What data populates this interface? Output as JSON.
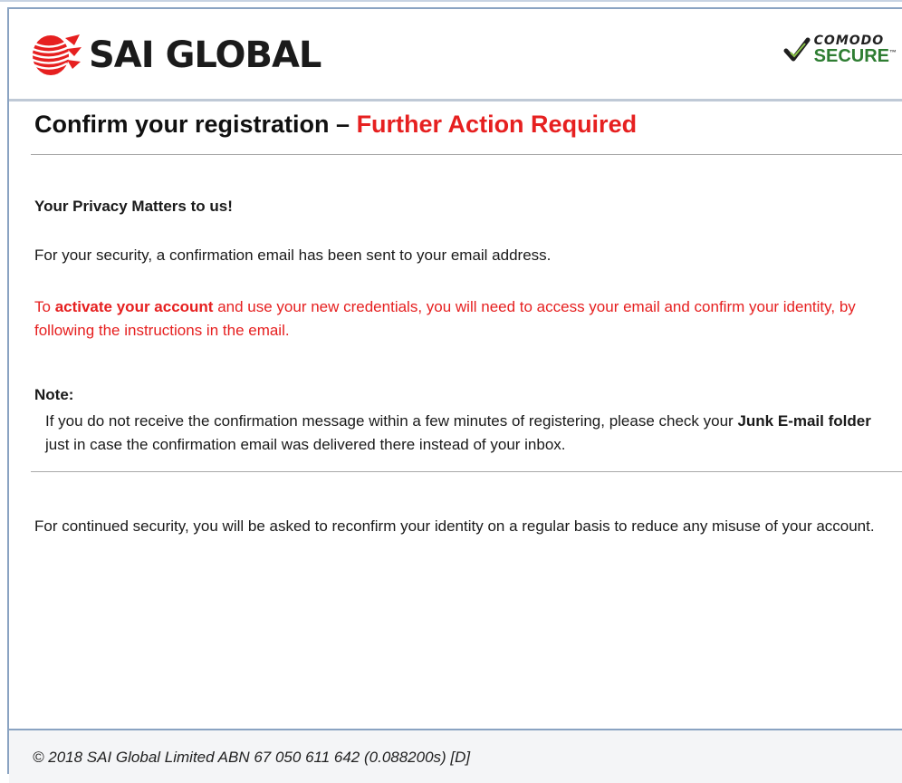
{
  "header": {
    "logo_text": "SAI GLOBAL",
    "badge_top": "COMODO",
    "badge_bottom": "SECURE",
    "badge_tm": "™"
  },
  "title": {
    "main": "Confirm your registration – ",
    "highlight": "Further Action Required"
  },
  "content": {
    "privacy_heading": "Your Privacy Matters to us!",
    "security_text": "For your security, a confirmation email has been sent to your email address.",
    "activate_pre": "To ",
    "activate_bold": "activate your account",
    "activate_post": " and use your new credentials, you will need to access your email and confirm your identity, by following the instructions in the email.",
    "note_heading": "Note:",
    "note_pre": "If you do not receive the confirmation message within a few minutes of registering, please check your ",
    "note_bold": "Junk E-mail folder",
    "note_post": " just in case the confirmation email was delivered there instead of your inbox.",
    "continued_text": "For continued security, you will be asked to reconfirm your identity on a regular basis to reduce any misuse of your account."
  },
  "footer": {
    "copyright": "© 2018 SAI Global Limited ABN 67 050 611 642 (0.088200s) [D]"
  },
  "colors": {
    "brand_red": "#e62020",
    "border_blue": "#8aa3c2",
    "comodo_green": "#2e7d32"
  }
}
